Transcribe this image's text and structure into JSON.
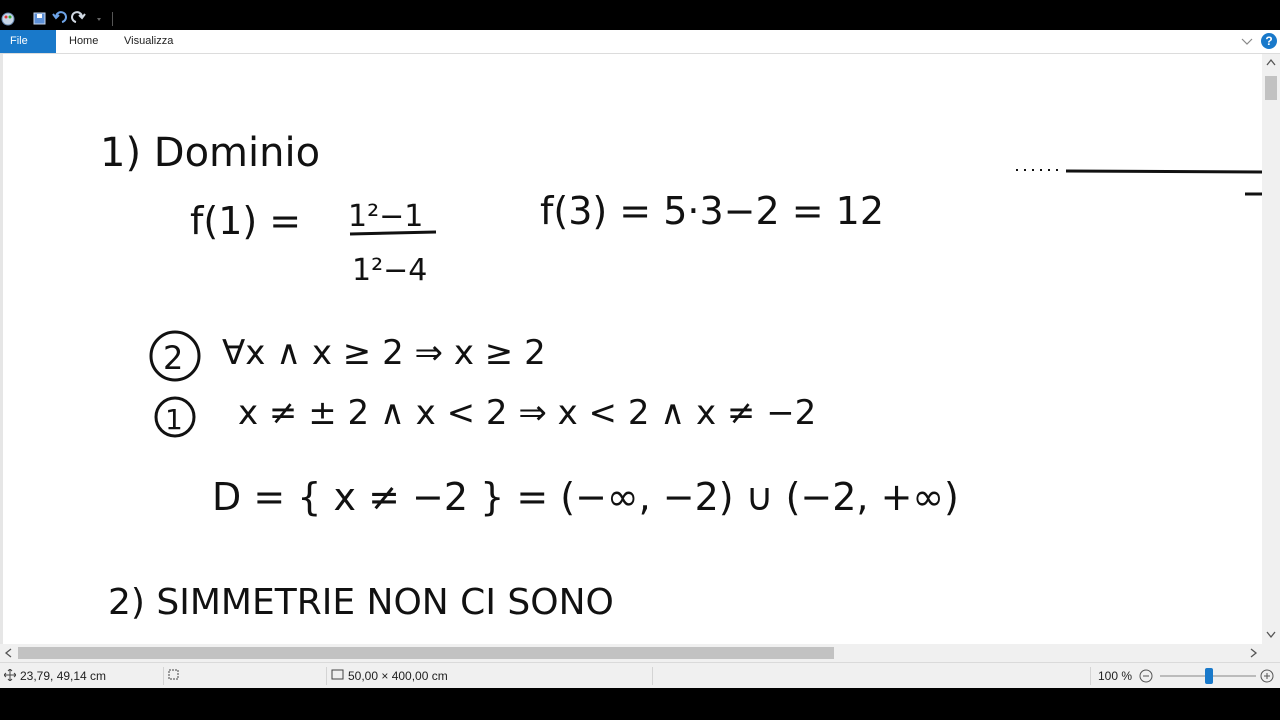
{
  "ribbon": {
    "tabs": [
      {
        "label": "File"
      },
      {
        "label": "Home"
      },
      {
        "label": "Visualizza"
      }
    ],
    "help_label": "?"
  },
  "canvas": {
    "notes": {
      "heading1": "1) Dominio",
      "f1_lhs": "f(1) =",
      "f1_num": "1²−1",
      "f1_den": "1²−4",
      "f3": "f(3) = 5·3−2 = 12",
      "case2_badge": "2",
      "case2": "∀x ∧ x ≥ 2  ⇒ x ≥ 2",
      "case1_badge": "1",
      "case1": "x ≠ ± 2 ∧ x < 2  ⇒  x < 2 ∧ x ≠ −2",
      "domain": "D = { x ≠ −2 }  = (−∞, −2) ∪ (−2, +∞)",
      "heading2": "2)  SIMMETRIE    NON CI SONO"
    }
  },
  "status": {
    "cursor_position": "23,79, 49,14  cm",
    "canvas_size": "50,00 × 400,00  cm",
    "zoom_label": "100 %",
    "zoom_fraction": 0.5
  }
}
